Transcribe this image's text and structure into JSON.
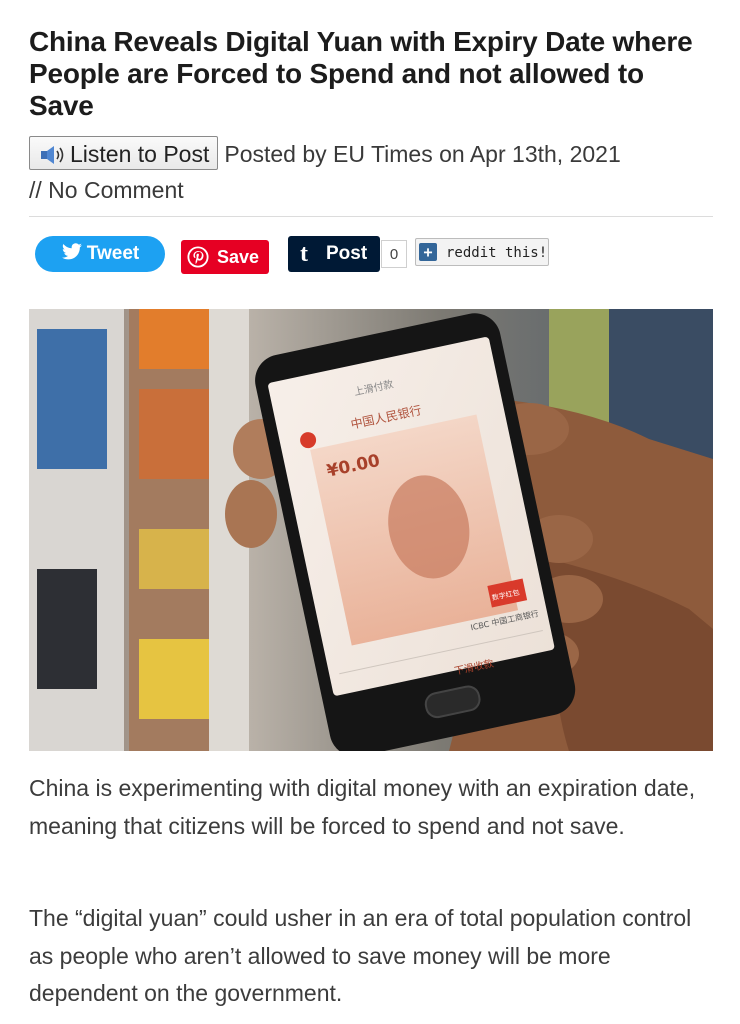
{
  "article": {
    "title": "China Reveals Digital Yuan with Expiry Date where People are Forced to Spend and not allowed to Save",
    "listen_label": "Listen to Post",
    "posted_by_prefix": "Posted by",
    "author": "EU Times",
    "date_prefix": "on",
    "date": "Apr 13th, 2021",
    "comments": "// No Comment"
  },
  "share": {
    "tweet_label": "Tweet",
    "save_label": "Save",
    "post_label": "Post",
    "post_count": "0",
    "reddit_label": "reddit this!"
  },
  "photo": {
    "phone_amount": "¥0.00",
    "phone_top_label": "中国人民银行",
    "phone_tab": "上滑付款",
    "phone_bottom": "下滑收款",
    "phone_bank": "ICBC 中国工商银行",
    "phone_badge": "数字红包"
  },
  "paragraphs": [
    "China is experimenting with digital money with an expiration date, meaning that citizens will be forced to spend and not save.",
    "The “digital yuan” could usher in an era of total population control as people who aren’t allowed to save money will be more dependent on the government."
  ],
  "colors": {
    "twitter": "#1da1f2",
    "pinterest": "#e60023",
    "tumblr": "#001935",
    "reddit_plus": "#336699"
  }
}
